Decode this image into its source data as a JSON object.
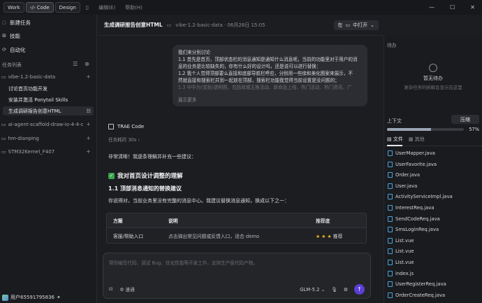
{
  "topbar": {
    "tabs": [
      {
        "label": "Work"
      },
      {
        "label": "Code"
      },
      {
        "label": "Design"
      }
    ],
    "menu": [
      "编辑(E)",
      "帮助(H)"
    ]
  },
  "sidebar": {
    "nav": [
      {
        "label": "新建任务",
        "icon": "chat-plus-icon"
      },
      {
        "label": "技能",
        "icon": "skills-icon"
      },
      {
        "label": "自动化",
        "icon": "automation-icon"
      }
    ],
    "section_label": "任务列表",
    "folders": [
      {
        "name": "vibe-1.2-basic-data"
      },
      {
        "name": "ai-agent-scaffold-draw-io-4-4-ch..."
      },
      {
        "name": "hm-dianping"
      },
      {
        "name": "STM32Kernel_F407"
      }
    ],
    "tasks": [
      {
        "label": "讨论首页功能开发"
      },
      {
        "label": "安装并激活 Ponytail Skills"
      },
      {
        "label": "生成调研报告创意HTML"
      }
    ],
    "user": "用户65591795836"
  },
  "header": {
    "title": "生成调研报告创意HTML",
    "crumb": "vibe-1.2-basic-data · 06月28日 15:05",
    "open_label": "在",
    "open_btn": "中打开"
  },
  "bubble": {
    "lines": [
      "我们来分别讨论",
      "1.1 首先是首页，顶部状态栏的消息通知是通知什么消息呢，当前的功能里对于用户的消",
      "息的业务是比较缺失的，你有什么好的设计吗，还是说可以进行替换：",
      "1.2 我个人觉得顶部要么直接和底部导航栏呼应，分别用一些徐和美化图案来展示，不",
      "然就直接和搜索栏并到一起放在顶部，搜索栏功能我觉得当前设置是没问题的；"
    ],
    "faded_line": "1.3 中中为(宝贴)透明图，包括商城主推活动、新商品上线、热门活动、热门资讯、广",
    "more": "展示更多"
  },
  "answer": {
    "agent": "TRAE Code",
    "time": "任务耗时 30s",
    "intro": "非常清晰！我逐条理解并补充一些建议：",
    "h1": "我对首页设计调整的理解",
    "h2": "1.1 顶部消息通知的替换建议",
    "para": "你说得对，当前业务里没有完整的消息中心。我建议替换消息通知，换成以下之一：",
    "table": {
      "headers": [
        "方案",
        "说明",
        "推荐度"
      ],
      "rows": [
        {
          "a": "客服/帮助入口",
          "b": "点击弹出常见问题或反馈入口，适合 demo",
          "stars": "★ ★ ★",
          "rec": "推荐"
        }
      ]
    }
  },
  "composer": {
    "placeholder": "帮你编写代码、调试 Bug、优化性能等开发工作，支持生产级代码产物。",
    "mode": "速通",
    "model": "GLM-5.2"
  },
  "right_panel": {
    "todo_label": "待办",
    "empty_title": "暂无待办",
    "empty_sub": "复杂任务的拆解会显示在这里",
    "ctx_label": "上下文",
    "compress": "压缩",
    "ctx_percent_text": "57%",
    "ctx_fraction": 0.57,
    "tabs": [
      "文件",
      "其他"
    ],
    "files": [
      "UserMapper.java",
      "UserFavorite.java",
      "Order.java",
      "User.java",
      "ActivityServiceImpl.java",
      "InterestReq.java",
      "SendCodeReq.java",
      "SmsLoginReq.java",
      "List.vue",
      "List.vue",
      "List.vue",
      "index.js",
      "UserRegisterReq.java",
      "OrderCreateReq.java"
    ]
  }
}
